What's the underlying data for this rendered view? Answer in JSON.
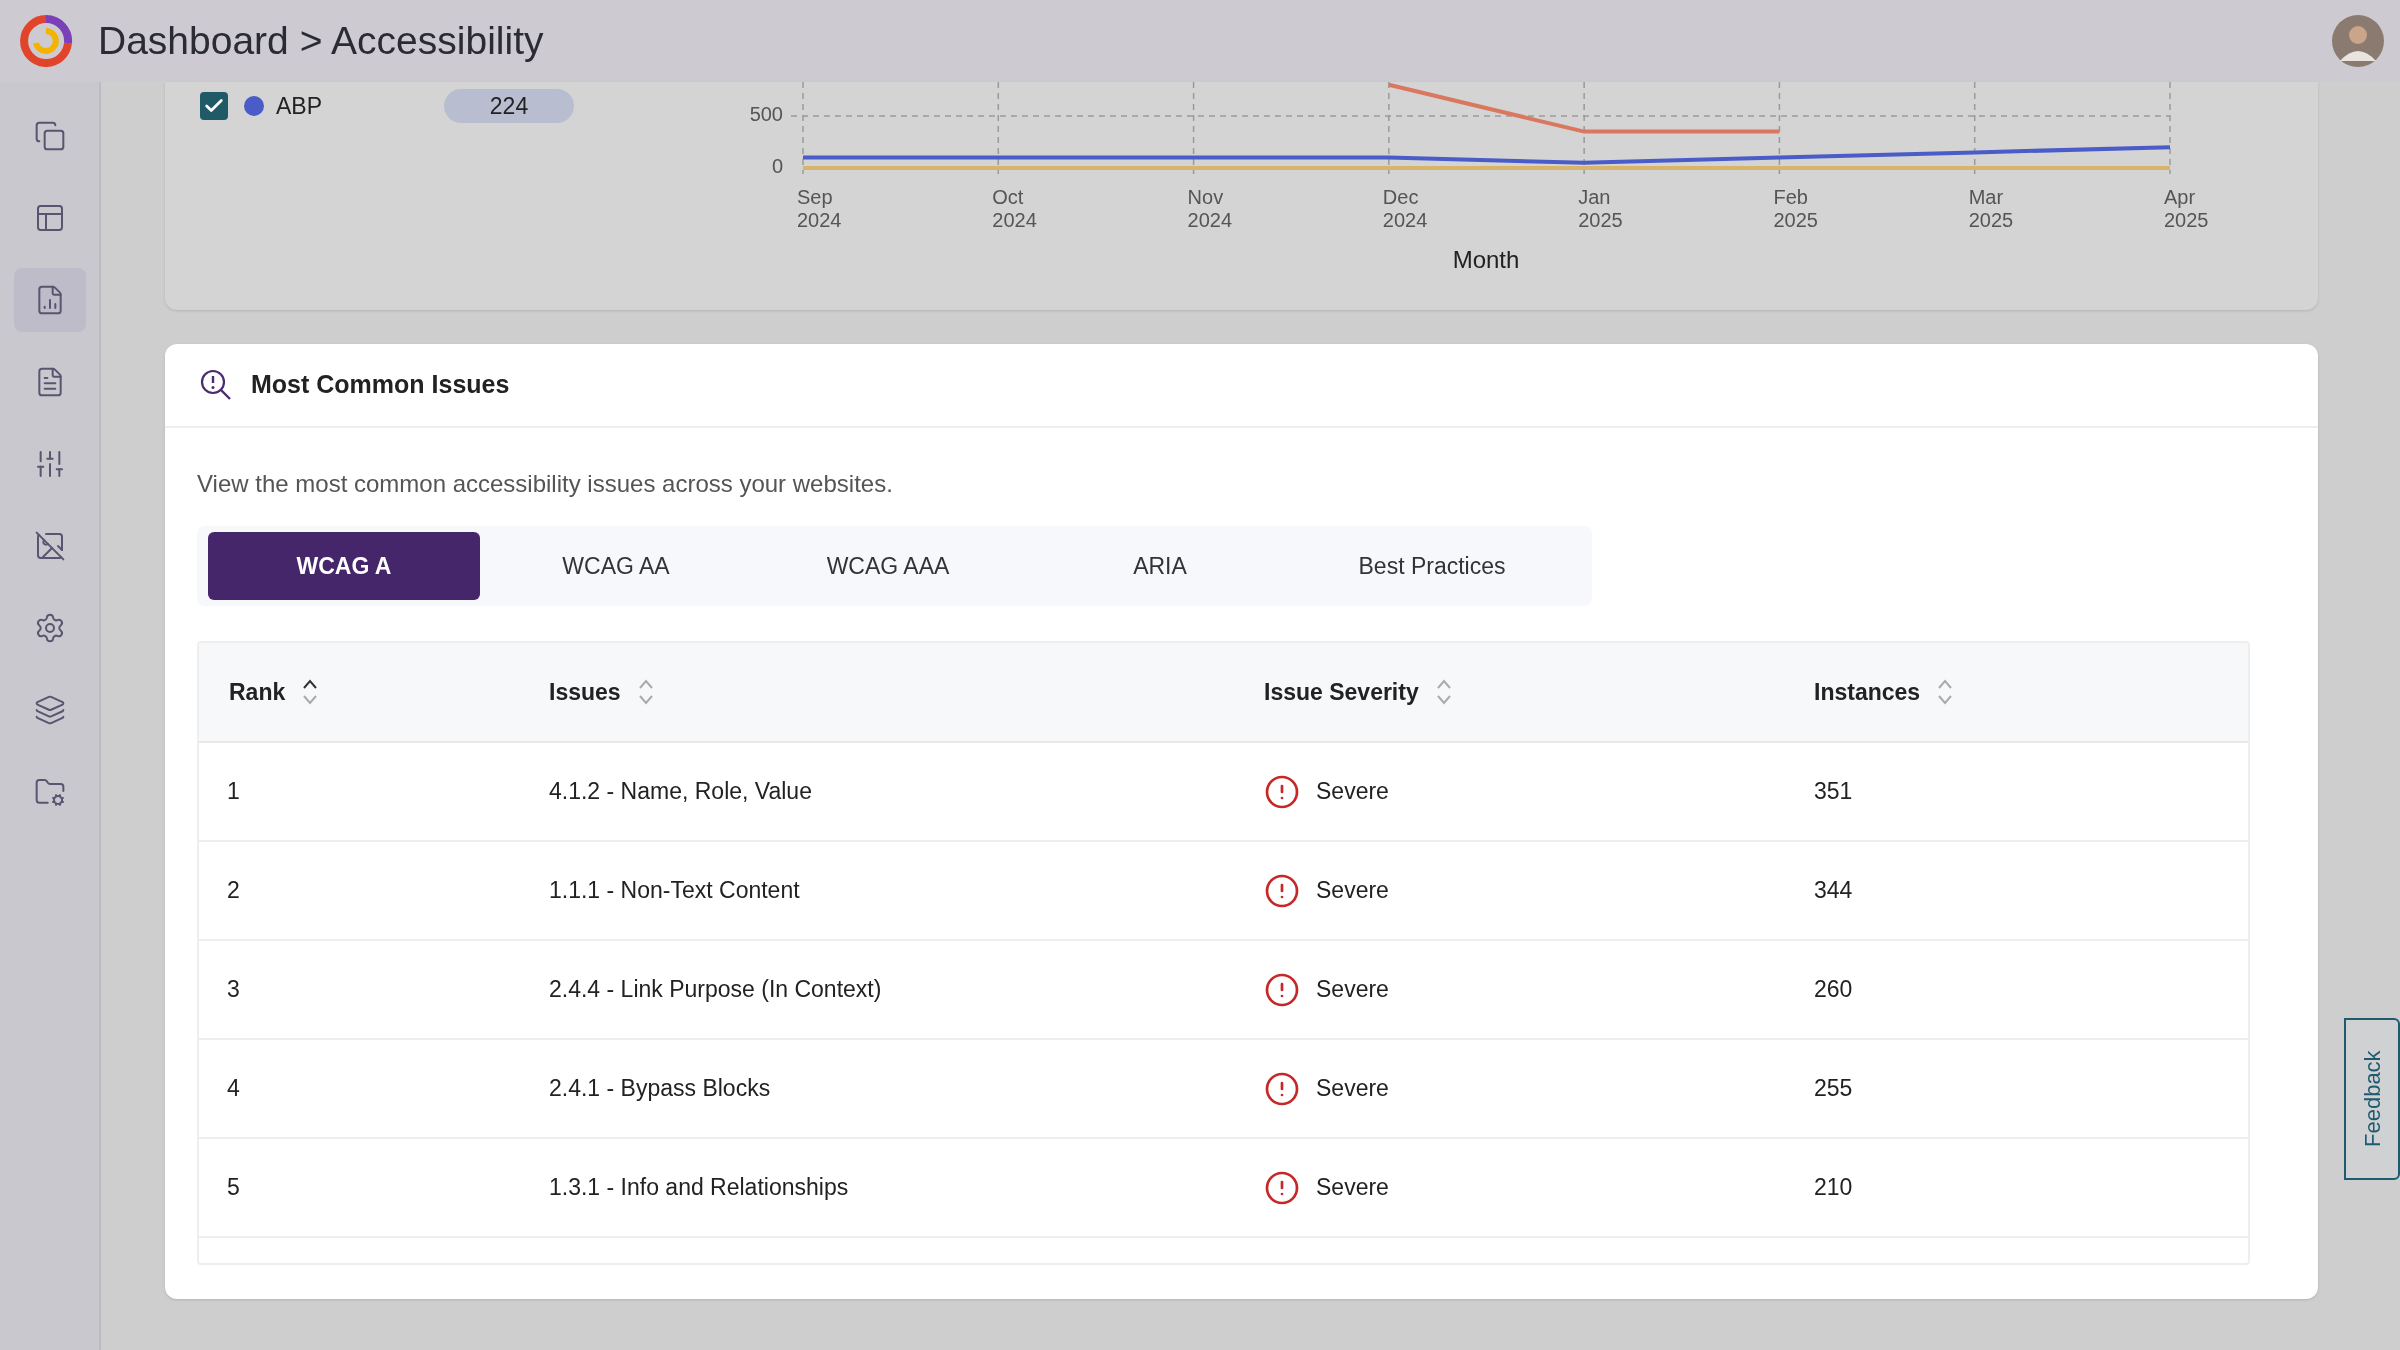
{
  "header": {
    "title": "Dashboard > Accessibility"
  },
  "sidebar": {
    "items": [
      {
        "selected": false
      },
      {
        "selected": false
      },
      {
        "selected": true
      },
      {
        "selected": false
      },
      {
        "selected": false
      },
      {
        "selected": false
      },
      {
        "selected": false
      },
      {
        "selected": false
      },
      {
        "selected": false
      }
    ]
  },
  "trend_card": {
    "legend": [
      {
        "label": "ABP",
        "checked": true,
        "color": "#4a5cc7",
        "count": "224"
      }
    ],
    "chart_data": {
      "type": "line",
      "xlabel": "Month",
      "categories": [
        "Sep 2024",
        "Oct 2024",
        "Nov 2024",
        "Dec 2024",
        "Jan 2025",
        "Feb 2025",
        "Mar 2025",
        "Apr 2025"
      ],
      "yticks": [
        0,
        500
      ],
      "ylim": [
        0,
        800
      ],
      "series": [
        {
          "color": "#4a5cc7",
          "values": [
            100,
            100,
            100,
            100,
            50,
            100,
            150,
            200
          ]
        },
        {
          "color": "#d9785f",
          "values": [
            null,
            null,
            null,
            800,
            350,
            350,
            null,
            null
          ]
        },
        {
          "color": "#d8b46a",
          "values": [
            0,
            0,
            0,
            0,
            0,
            0,
            0,
            0
          ]
        }
      ]
    }
  },
  "issues_card": {
    "title": "Most Common Issues",
    "description": "View the most common accessibility issues across your websites.",
    "tabs": [
      {
        "label": "WCAG A",
        "selected": true
      },
      {
        "label": "WCAG AA",
        "selected": false
      },
      {
        "label": "WCAG AAA",
        "selected": false
      },
      {
        "label": "ARIA",
        "selected": false
      },
      {
        "label": "Best Practices",
        "selected": false
      }
    ],
    "table": {
      "columns": [
        {
          "label": "Rank",
          "sorted": true
        },
        {
          "label": "Issues",
          "sorted": false
        },
        {
          "label": "Issue Severity",
          "sorted": false
        },
        {
          "label": "Instances",
          "sorted": false
        }
      ],
      "rows": [
        {
          "rank": "1",
          "issue": "4.1.2 - Name, Role, Value",
          "severity": "Severe",
          "instances": "351"
        },
        {
          "rank": "2",
          "issue": "1.1.1 - Non-Text Content",
          "severity": "Severe",
          "instances": "344"
        },
        {
          "rank": "3",
          "issue": "2.4.4 - Link Purpose (In Context)",
          "severity": "Severe",
          "instances": "260"
        },
        {
          "rank": "4",
          "issue": "2.4.1 - Bypass Blocks",
          "severity": "Severe",
          "instances": "255"
        },
        {
          "rank": "5",
          "issue": "1.3.1 - Info and Relationships",
          "severity": "Severe",
          "instances": "210"
        }
      ]
    }
  },
  "feedback": {
    "label": "Feedback"
  }
}
